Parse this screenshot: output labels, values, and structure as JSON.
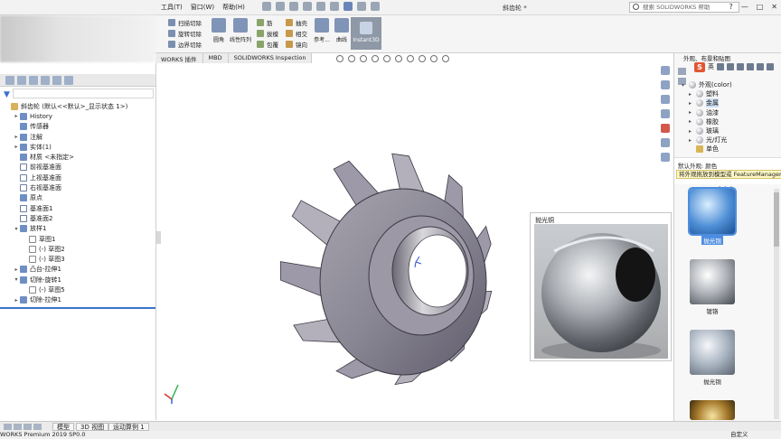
{
  "titlebar": {
    "menu": [
      "工具(T)",
      "窗口(W)",
      "帮助(H)"
    ],
    "doc_title": "斜齿轮 *",
    "search_placeholder": "搜索 SOLIDWORKS 帮助",
    "win_buttons": [
      "?",
      "—",
      "□",
      "✕"
    ]
  },
  "ribbon": {
    "col1": [
      "扫描切除",
      "旋转切除",
      "边界切除"
    ],
    "col2": [
      "圆角",
      "线性阵列"
    ],
    "col3": [
      "筋",
      "抽壳",
      "包覆",
      "镜向",
      "拔模",
      "相交"
    ],
    "col4": [
      "参考...",
      "曲线"
    ],
    "instant3d": "Instant3D"
  },
  "tabs": [
    "WORKS 插件",
    "MBD",
    "SOLIDWORKS Inspection"
  ],
  "feature_tree": {
    "rows": [
      {
        "exp": "",
        "text": "斜齿轮 (默认<<默认>_显示状态 1>)",
        "kind": "part",
        "indent": 0
      },
      {
        "exp": "▸",
        "text": "History",
        "kind": "feat",
        "indent": 1
      },
      {
        "exp": "",
        "text": "传感器",
        "kind": "feat",
        "indent": 1
      },
      {
        "exp": "▸",
        "text": "注解",
        "kind": "feat",
        "indent": 1
      },
      {
        "exp": "▸",
        "text": "实体(1)",
        "kind": "feat",
        "indent": 1
      },
      {
        "exp": "",
        "text": "材质 <未指定>",
        "kind": "feat",
        "indent": 1
      },
      {
        "exp": "",
        "text": "前视基准面",
        "kind": "plane",
        "indent": 1
      },
      {
        "exp": "",
        "text": "上视基准面",
        "kind": "plane",
        "indent": 1
      },
      {
        "exp": "",
        "text": "右视基准面",
        "kind": "plane",
        "indent": 1
      },
      {
        "exp": "",
        "text": "原点",
        "kind": "feat",
        "indent": 1
      },
      {
        "exp": "",
        "text": "基准面1",
        "kind": "plane",
        "indent": 1
      },
      {
        "exp": "",
        "text": "基准面2",
        "kind": "plane",
        "indent": 1
      },
      {
        "exp": "▾",
        "text": "放样1",
        "kind": "feat",
        "indent": 1
      },
      {
        "exp": "",
        "text": "草图1",
        "kind": "sketch",
        "indent": 2
      },
      {
        "exp": "",
        "text": "(-) 草图2",
        "kind": "sketch",
        "indent": 2
      },
      {
        "exp": "",
        "text": "(-) 草图3",
        "kind": "sketch",
        "indent": 2
      },
      {
        "exp": "▸",
        "text": "凸台-拉伸1",
        "kind": "feat",
        "indent": 1
      },
      {
        "exp": "▾",
        "text": "切除-旋转1",
        "kind": "feat",
        "indent": 1
      },
      {
        "exp": "",
        "text": "(-) 草图5",
        "kind": "sketch",
        "indent": 2
      },
      {
        "exp": "▸",
        "text": "切除-拉伸1",
        "kind": "feat",
        "indent": 1
      }
    ]
  },
  "bottom_tabs": [
    "模型",
    "3D 视图",
    "运动算例 1"
  ],
  "status": {
    "left": "WORKS Premium 2019 SP0.0",
    "right": "自定义"
  },
  "popup": {
    "title": "抛光铜"
  },
  "right_panel": {
    "header": "外观、布景和贴图",
    "ime": "英",
    "tree": [
      {
        "exp": "▾",
        "text": "外观(color)",
        "icon": "sphere",
        "indent": 0,
        "selected": false
      },
      {
        "exp": "▸",
        "text": "塑料",
        "icon": "sphere",
        "indent": 1,
        "selected": false
      },
      {
        "exp": "▸",
        "text": "金属",
        "icon": "sphere",
        "indent": 1,
        "selected": true
      },
      {
        "exp": "▸",
        "text": "油漆",
        "icon": "sphere",
        "indent": 1,
        "selected": false
      },
      {
        "exp": "▸",
        "text": "橡胶",
        "icon": "sphere",
        "indent": 1,
        "selected": false
      },
      {
        "exp": "▸",
        "text": "玻璃",
        "icon": "sphere",
        "indent": 1,
        "selected": false
      },
      {
        "exp": "▸",
        "text": "光/灯光",
        "icon": "sphere",
        "indent": 1,
        "selected": false
      },
      {
        "exp": "",
        "text": "单色",
        "icon": "folder",
        "indent": 1,
        "selected": false
      }
    ],
    "info_title": "默认外观: 颜色",
    "info_tip": "将外观拖放到模型或 FeatureManager",
    "separator": "• • •",
    "swatches": [
      {
        "label": "抛光铜",
        "style": "blue",
        "selected": true
      },
      {
        "label": "镀铬",
        "style": "chrome",
        "selected": false
      },
      {
        "label": "抛光铜",
        "style": "silver",
        "selected": false
      },
      {
        "label": "",
        "style": "gold",
        "selected": false
      }
    ]
  },
  "colors": {
    "accent": "#3b74c9",
    "gear": "#8f8b99",
    "selection": "#4d8de0"
  }
}
